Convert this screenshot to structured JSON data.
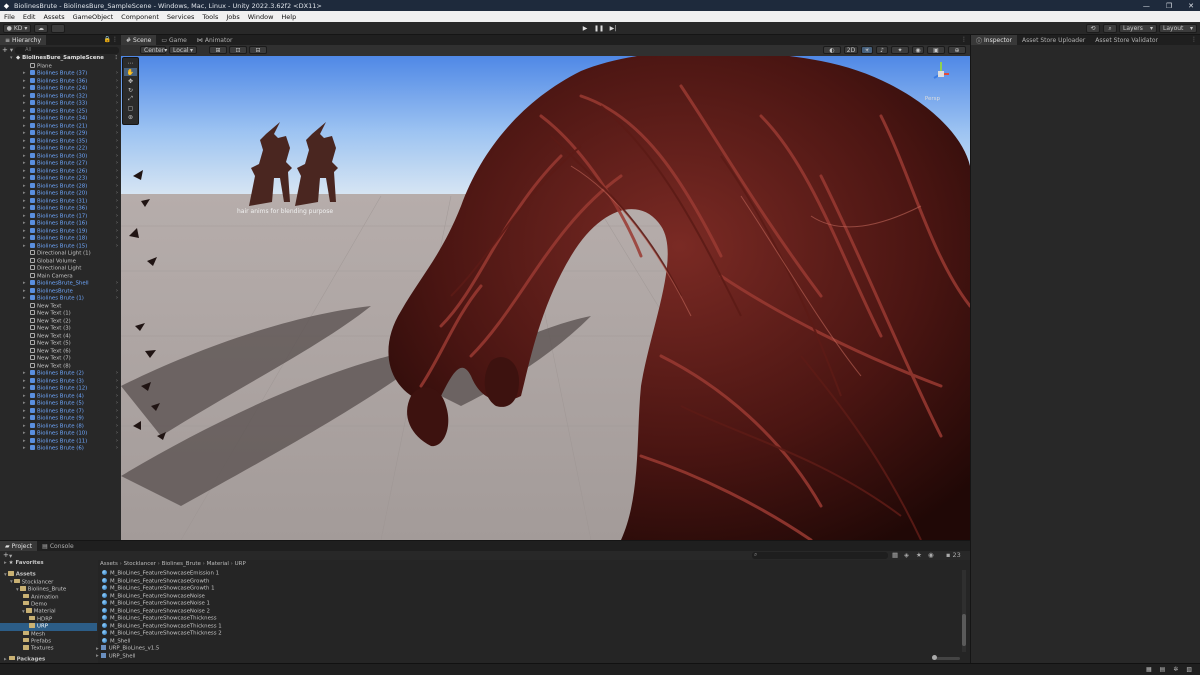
{
  "window": {
    "title": "BiolinesBrute - BiolinesBure_SampleScene - Windows, Mac, Linux - Unity 2022.3.62f2 <DX11>"
  },
  "menu": [
    "File",
    "Edit",
    "Assets",
    "GameObject",
    "Component",
    "Services",
    "Tools",
    "Jobs",
    "Window",
    "Help"
  ],
  "toolbar": {
    "account": "KD",
    "layers": "Layers",
    "layout": "Layout"
  },
  "hierarchy": {
    "tab": "Hierarchy",
    "search_placeholder": "All",
    "scene": "BiolinesBure_SampleScene",
    "items": [
      {
        "label": "Plane",
        "kind": "obj",
        "arrow": false
      },
      {
        "label": "Biolines Brute (37)",
        "kind": "prefab",
        "arrow": true
      },
      {
        "label": "Biolines Brute (36)",
        "kind": "prefab",
        "arrow": true
      },
      {
        "label": "Biolines Brute (24)",
        "kind": "prefab",
        "arrow": true
      },
      {
        "label": "Biolines Brute (32)",
        "kind": "prefab",
        "arrow": true
      },
      {
        "label": "Biolines Brute (33)",
        "kind": "prefab",
        "arrow": true
      },
      {
        "label": "Biolines Brute (25)",
        "kind": "prefab",
        "arrow": true
      },
      {
        "label": "Biolines Brute (34)",
        "kind": "prefab",
        "arrow": true
      },
      {
        "label": "Biolines Brute (21)",
        "kind": "prefab",
        "arrow": true
      },
      {
        "label": "Biolines Brute (29)",
        "kind": "prefab",
        "arrow": true
      },
      {
        "label": "Biolines Brute (35)",
        "kind": "prefab",
        "arrow": true
      },
      {
        "label": "Biolines Brute (22)",
        "kind": "prefab",
        "arrow": true
      },
      {
        "label": "Biolines Brute (30)",
        "kind": "prefab",
        "arrow": true
      },
      {
        "label": "Biolines Brute (27)",
        "kind": "prefab",
        "arrow": true
      },
      {
        "label": "Biolines Brute (26)",
        "kind": "prefab",
        "arrow": true
      },
      {
        "label": "Biolines Brute (23)",
        "kind": "prefab",
        "arrow": true
      },
      {
        "label": "Biolines Brute (28)",
        "kind": "prefab",
        "arrow": true
      },
      {
        "label": "Biolines Brute (20)",
        "kind": "prefab",
        "arrow": true
      },
      {
        "label": "Biolines Brute (31)",
        "kind": "prefab",
        "arrow": true
      },
      {
        "label": "Biolines Brute (36)",
        "kind": "prefab",
        "arrow": true
      },
      {
        "label": "Biolines Brute (17)",
        "kind": "prefab",
        "arrow": true
      },
      {
        "label": "Biolines Brute (16)",
        "kind": "prefab",
        "arrow": true
      },
      {
        "label": "Biolines Brute (19)",
        "kind": "prefab",
        "arrow": true
      },
      {
        "label": "Biolines Brute (18)",
        "kind": "prefab",
        "arrow": true
      },
      {
        "label": "Biolines Brute (15)",
        "kind": "prefab",
        "arrow": true
      },
      {
        "label": "Directional Light (1)",
        "kind": "obj",
        "arrow": false
      },
      {
        "label": "Global Volume",
        "kind": "obj",
        "arrow": false
      },
      {
        "label": "Directional Light",
        "kind": "obj",
        "arrow": false
      },
      {
        "label": "Main Camera",
        "kind": "obj",
        "arrow": false
      },
      {
        "label": "BiolinesBrute_Shell",
        "kind": "prefab",
        "arrow": true
      },
      {
        "label": "BiolinesBrute",
        "kind": "prefab",
        "arrow": true
      },
      {
        "label": "Biolines Brute (1)",
        "kind": "prefab",
        "arrow": true
      },
      {
        "label": "New Text",
        "kind": "obj",
        "arrow": false
      },
      {
        "label": "New Text (1)",
        "kind": "obj",
        "arrow": false
      },
      {
        "label": "New Text (2)",
        "kind": "obj",
        "arrow": false
      },
      {
        "label": "New Text (3)",
        "kind": "obj",
        "arrow": false
      },
      {
        "label": "New Text (4)",
        "kind": "obj",
        "arrow": false
      },
      {
        "label": "New Text (5)",
        "kind": "obj",
        "arrow": false
      },
      {
        "label": "New Text (6)",
        "kind": "obj",
        "arrow": false
      },
      {
        "label": "New Text (7)",
        "kind": "obj",
        "arrow": false
      },
      {
        "label": "New Text (8)",
        "kind": "obj",
        "arrow": false
      },
      {
        "label": "Biolines Brute (2)",
        "kind": "prefab",
        "arrow": true
      },
      {
        "label": "Biolines Brute (3)",
        "kind": "prefab",
        "arrow": true
      },
      {
        "label": "Biolines Brute (12)",
        "kind": "prefab",
        "arrow": true
      },
      {
        "label": "Biolines Brute (4)",
        "kind": "prefab",
        "arrow": true
      },
      {
        "label": "Biolines Brute (5)",
        "kind": "prefab",
        "arrow": true
      },
      {
        "label": "Biolines Brute (7)",
        "kind": "prefab",
        "arrow": true
      },
      {
        "label": "Biolines Brute (9)",
        "kind": "prefab",
        "arrow": true
      },
      {
        "label": "Biolines Brute (8)",
        "kind": "prefab",
        "arrow": true
      },
      {
        "label": "Biolines Brute (10)",
        "kind": "prefab",
        "arrow": true
      },
      {
        "label": "Biolines Brute (11)",
        "kind": "prefab",
        "arrow": true
      },
      {
        "label": "Biolines Brute (6)",
        "kind": "prefab",
        "arrow": true
      }
    ]
  },
  "scene": {
    "tabs": [
      "Scene",
      "Game",
      "Animator"
    ],
    "pivot": "Center",
    "space": "Local",
    "mode_2d": "2D",
    "label": "hair anims for blending purpose",
    "persp": "Persp"
  },
  "inspector": {
    "tabs": [
      "Inspector",
      "Asset Store Uploader",
      "Asset Store Validator"
    ]
  },
  "project": {
    "tabs": [
      "Project",
      "Console"
    ],
    "count": "23",
    "favorites": "Favorites",
    "tree": [
      {
        "label": "Assets",
        "head": true,
        "sel": false
      },
      {
        "label": "Stocklancer",
        "head": false,
        "sel": false
      },
      {
        "label": "Biolines_Brute",
        "head": false,
        "sel": false
      },
      {
        "label": "Animation",
        "head": false,
        "sel": false
      },
      {
        "label": "Demo",
        "head": false,
        "sel": false
      },
      {
        "label": "Material",
        "head": false,
        "sel": false
      },
      {
        "label": "HDRP",
        "head": false,
        "sel": false
      },
      {
        "label": "URP",
        "head": false,
        "sel": true
      },
      {
        "label": "Mesh",
        "head": false,
        "sel": false
      },
      {
        "label": "Prefabs",
        "head": false,
        "sel": false
      },
      {
        "label": "Textures",
        "head": false,
        "sel": false
      }
    ],
    "packages": "Packages",
    "breadcrumb": [
      "Assets",
      "Stocklancer",
      "Biolines_Brute",
      "Material",
      "URP"
    ],
    "files": [
      {
        "name": "M_BioLines_FeatureShowcaseEmission 1",
        "type": "mat"
      },
      {
        "name": "M_BioLines_FeatureShowcaseGrowth",
        "type": "mat"
      },
      {
        "name": "M_BioLines_FeatureShowcaseGrowth 1",
        "type": "mat"
      },
      {
        "name": "M_BioLines_FeatureShowcaseNoise",
        "type": "mat"
      },
      {
        "name": "M_BioLines_FeatureShowcaseNoise 1",
        "type": "mat"
      },
      {
        "name": "M_BioLines_FeatureShowcaseNoise 2",
        "type": "mat"
      },
      {
        "name": "M_BioLines_FeatureShowcaseThickness",
        "type": "mat"
      },
      {
        "name": "M_BioLines_FeatureShowcaseThickness 1",
        "type": "mat"
      },
      {
        "name": "M_BioLines_FeatureShowcaseThickness 2",
        "type": "mat"
      },
      {
        "name": "M_Shell",
        "type": "mat"
      },
      {
        "name": "URP_BioLines_v1.5",
        "type": "shader"
      },
      {
        "name": "URP_Shell",
        "type": "shader"
      }
    ]
  }
}
